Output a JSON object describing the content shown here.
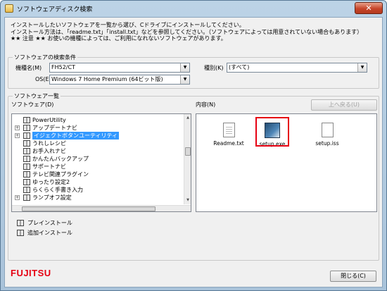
{
  "window": {
    "title": "ソフトウェアディスク検索",
    "close_glyph": "✕"
  },
  "intro": {
    "line1": "インストールしたいソフトウェアを一覧から選び、Cドライブにインストールしてください。",
    "line2": "インストール方法は、「readme.txt」「install.txt」などを参照してください。（ソフトウェアによっては用意されていない場合もあります）",
    "line3": "★★ 注意 ★★ お使いの機種によっては、ご利用になれないソフトウェアがあります。"
  },
  "search": {
    "group_title": "ソフトウェアの検索条件",
    "model_label": "機種名(M)",
    "model_value": "FH52/CT",
    "type_label": "種別(K)",
    "type_value": "(すべて)",
    "os_label": "OS(E)",
    "os_value": "Windows 7 Home Premium (64ビット版)"
  },
  "list": {
    "group_title": "ソフトウェア一覧",
    "software_label": "ソフトウェア(D)",
    "contents_label": "内容(N)",
    "up_button": "上へ戻る(U)",
    "items": [
      {
        "label": "PowerUtility",
        "expander": ""
      },
      {
        "label": "アップデートナビ",
        "expander": "+"
      },
      {
        "label": "イジェクトボタンユーティリティ",
        "expander": "+"
      },
      {
        "label": "うれしレシピ",
        "expander": ""
      },
      {
        "label": "お手入れナビ",
        "expander": ""
      },
      {
        "label": "かんたんバックアップ",
        "expander": ""
      },
      {
        "label": "サポートナビ",
        "expander": ""
      },
      {
        "label": "テレビ関連プラグイン",
        "expander": ""
      },
      {
        "label": "ゆったり設定2",
        "expander": ""
      },
      {
        "label": "らくらく手書き入力",
        "expander": ""
      },
      {
        "label": "ランプオフ設定",
        "expander": "+"
      }
    ],
    "selected_index": 2,
    "files": [
      {
        "name": "Readme.txt",
        "icon": "text-document-icon"
      },
      {
        "name": "setup.exe",
        "icon": "setup-exe-icon"
      },
      {
        "name": "setup.iss",
        "icon": "blank-document-icon"
      }
    ]
  },
  "actions": {
    "preinstall": "プレインストール",
    "additional": "追加インストール"
  },
  "footer": {
    "brand": "FUJITSU",
    "close_button": "閉じる(C)"
  },
  "colors": {
    "accent": "#3399ff",
    "brand": "#e60012"
  }
}
